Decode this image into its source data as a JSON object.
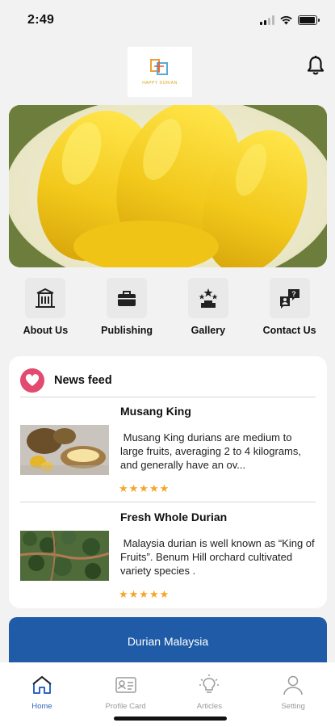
{
  "status_bar": {
    "time": "2:49",
    "battery_level": 0.95,
    "signal_bars": 2
  },
  "header": {
    "logo_text": "HAPPY DURIAN",
    "notification_icon": "bell-icon"
  },
  "hero": {
    "image": "durian-fruit-flesh-photo"
  },
  "menu": [
    {
      "label": "About Us",
      "icon": "building-icon"
    },
    {
      "label": "Publishing",
      "icon": "briefcase-icon"
    },
    {
      "label": "Gallery",
      "icon": "stars-trophy-icon"
    },
    {
      "label": "Contact Us",
      "icon": "contact-chat-icon"
    }
  ],
  "news_feed": {
    "title": "News feed",
    "icon": "heart-icon",
    "items": [
      {
        "title": "Musang King",
        "description": " Musang King durians are medium to large fruits, averaging 2 to 4 kilograms, and generally have an ov...",
        "rating": 5,
        "stars": "★★★★★",
        "thumbnail": "durian-musang-king-photo"
      },
      {
        "title": "Fresh Whole Durian",
        "description": " Malaysia durian is well known as “King of Fruits”. Benum Hill orchard cultivated variety species .",
        "rating": 5,
        "stars": "★★★★★",
        "thumbnail": "durian-orchard-aerial-photo"
      }
    ]
  },
  "banner": {
    "text": "Durian Malaysia",
    "color": "#1f5ba6"
  },
  "tabs": [
    {
      "label": "Home",
      "icon": "home-icon",
      "active": true
    },
    {
      "label": "Profile Card",
      "icon": "id-card-icon",
      "active": false
    },
    {
      "label": "Articles",
      "icon": "lightbulb-icon",
      "active": false
    },
    {
      "label": "Setting",
      "icon": "person-icon",
      "active": false
    }
  ],
  "colors": {
    "accent": "#2f66c0",
    "heart": "#e34a6f",
    "star": "#f5a623",
    "banner": "#1f5ba6"
  }
}
